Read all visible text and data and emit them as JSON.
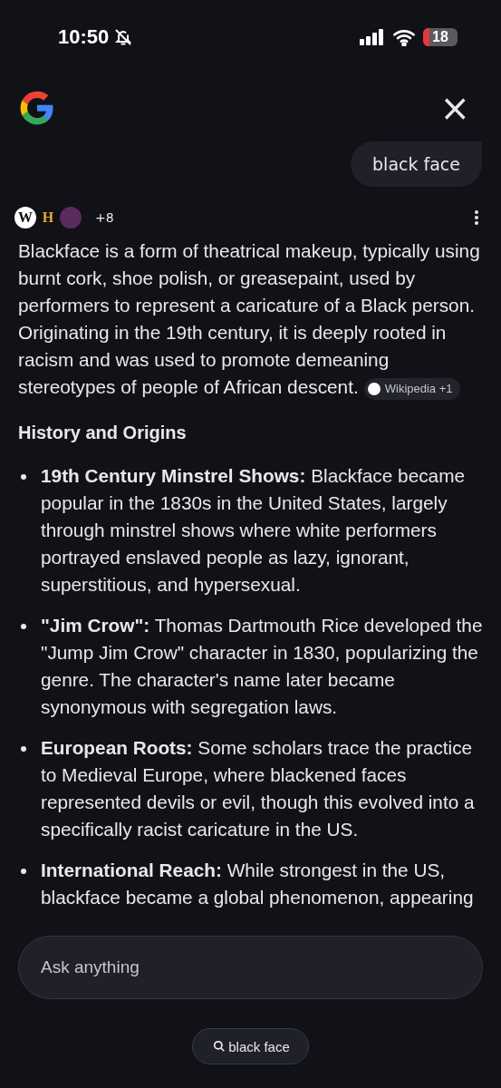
{
  "status_bar": {
    "time": "10:50",
    "silent": true,
    "battery": "18"
  },
  "header": {
    "close_label": "×"
  },
  "query": "black face",
  "sources": {
    "logos": [
      {
        "kind": "wiki",
        "letter": "W"
      },
      {
        "kind": "history",
        "letter": "H"
      },
      {
        "kind": "plain"
      }
    ],
    "more": "+8"
  },
  "answer": {
    "text": "Blackface is a form of theatrical makeup, typically using burnt cork, shoe polish, or greasepaint, used by performers to represent a caricature of a Black person. Originating in the 19th century, it is deeply rooted in racism and was used to promote demeaning stereotypes of people of African descent.",
    "citation": "Wikipedia +1"
  },
  "section_heading": "History and Origins",
  "bullets": [
    {
      "text": "**19th Century Minstrel Shows:** Blackface became popular in the 1830s in the United States, largely through minstrel shows where white performers portrayed enslaved people as lazy, ignorant, superstitious, and hypersexual."
    },
    {
      "text": "**\"Jim Crow\":** Thomas Dartmouth Rice developed the \"Jump Jim Crow\" character in 1830, popularizing the genre. The character's name later became synonymous with segregation laws."
    },
    {
      "text": "**European Roots:** Some scholars trace the practice to Medieval Europe, where blackened faces represented devils or evil, though this evolved into a specifically racist caricature in the US."
    },
    {
      "text": "**International Reach:** While strongest in the US, blackface became a global phenomenon, appearing"
    }
  ],
  "ask_field": {
    "placeholder": "Ask anything"
  },
  "search_chip": "black face"
}
